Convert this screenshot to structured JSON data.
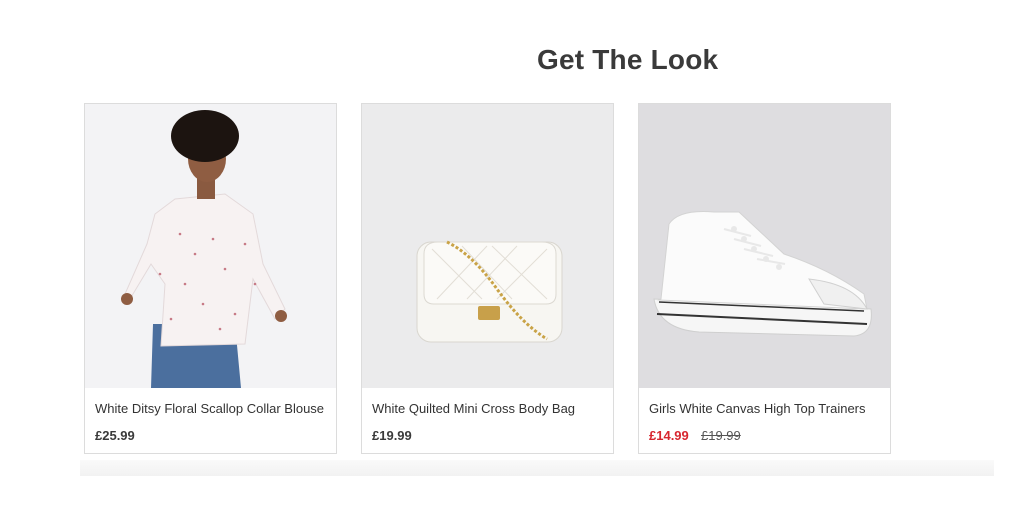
{
  "section": {
    "title": "Get The Look"
  },
  "products": [
    {
      "name": "White Ditsy Floral Scallop Collar Blouse",
      "price": "£25.99",
      "image": "blouse-photo"
    },
    {
      "name": "White Quilted Mini Cross Body Bag",
      "price": "£19.99",
      "image": "bag-photo"
    },
    {
      "name": "Girls White Canvas High Top Trainers",
      "sale_price": "£14.99",
      "was_price": "£19.99",
      "image": "trainers-photo",
      "sale_color": "#d7262f"
    }
  ]
}
